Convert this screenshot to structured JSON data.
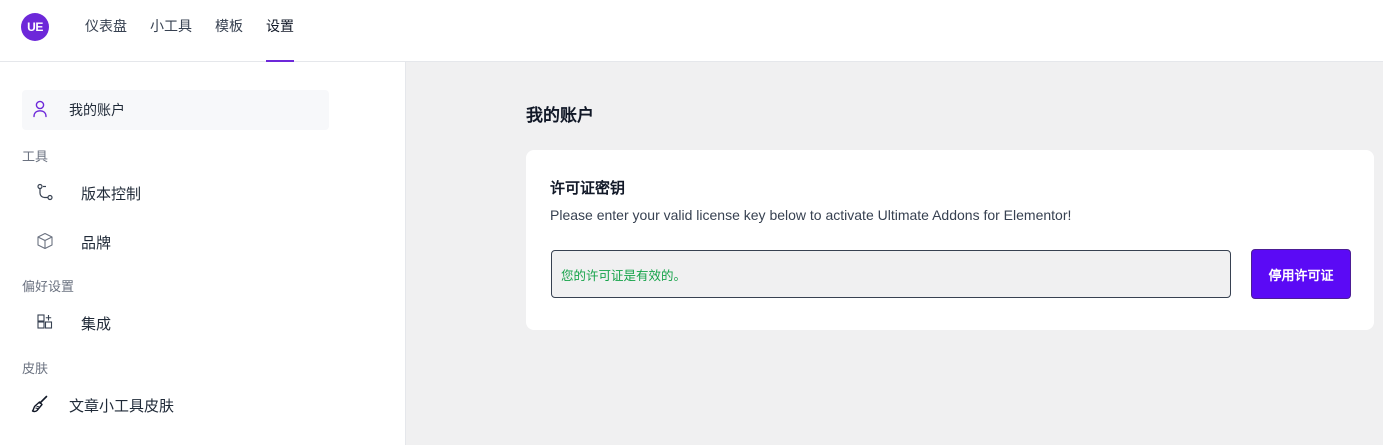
{
  "brand": {
    "logo_text": "UE",
    "accent": "#6d28d9"
  },
  "topnav": {
    "items": [
      "仪表盘",
      "小工具",
      "模板",
      "设置"
    ],
    "active": "设置"
  },
  "sidebar": {
    "active_item": {
      "label": "我的账户",
      "icon": "user-icon"
    },
    "sections": [
      {
        "title": "工具",
        "items": [
          {
            "label": "版本控制",
            "icon": "git-branch-icon"
          },
          {
            "label": "品牌",
            "icon": "package-icon"
          }
        ]
      },
      {
        "title": "偏好设置",
        "items": [
          {
            "label": "集成",
            "icon": "grid-plus-icon"
          }
        ]
      },
      {
        "title": "皮肤",
        "items": [
          {
            "label": "文章小工具皮肤",
            "icon": "brush-icon"
          }
        ]
      }
    ]
  },
  "main": {
    "title": "我的账户",
    "card": {
      "title": "许可证密钥",
      "description": "Please enter your valid license key below to activate Ultimate Addons for Elementor!",
      "input_value": "您的许可证是有效的。",
      "button_label": "停用许可证",
      "button_color": "#5b0af5",
      "status_color": "#16a34a"
    }
  }
}
